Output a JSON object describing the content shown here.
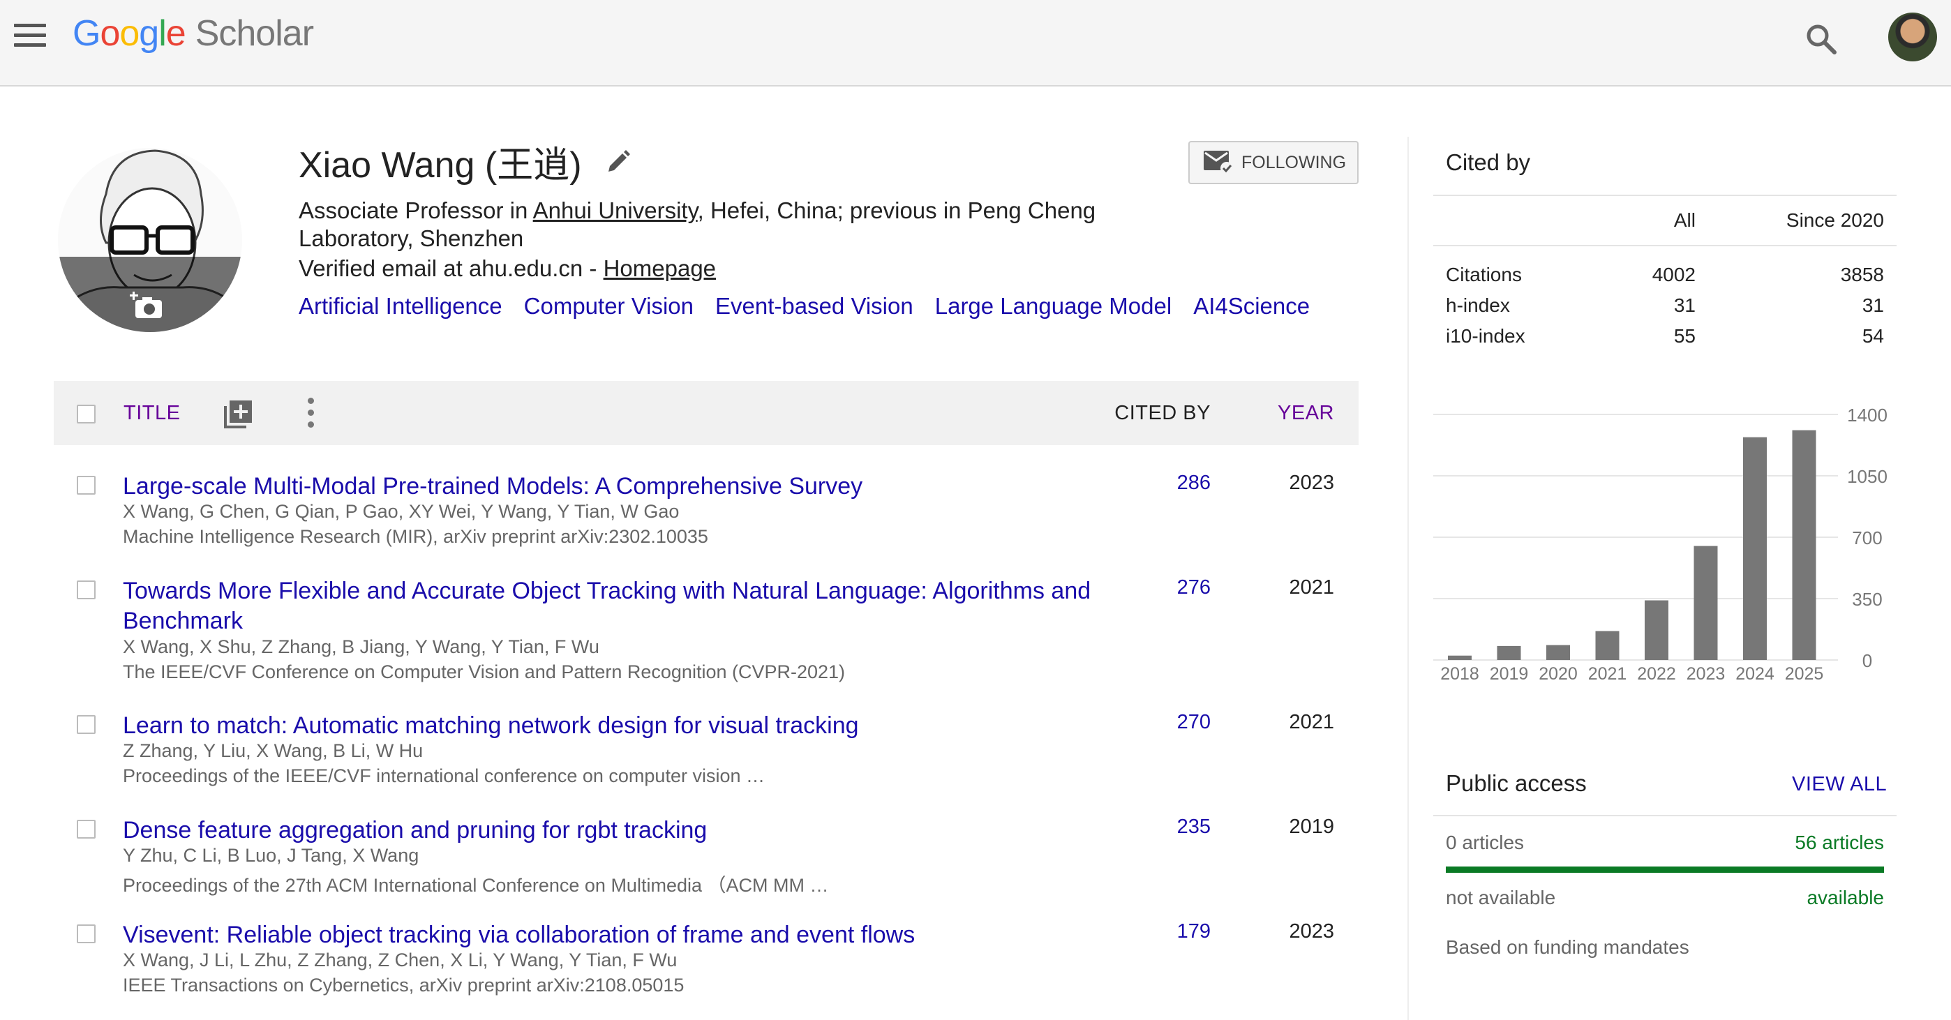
{
  "header": {
    "logo_google": "Google",
    "logo_scholar": "Scholar"
  },
  "profile": {
    "name": "Xiao Wang (王逍)",
    "affiliation_prefix": "Associate Professor in ",
    "affiliation_link": "Anhui University",
    "affiliation_suffix": ", Hefei, China; previous in Peng Cheng Laboratory, Shenzhen",
    "email_text": "Verified email at ahu.edu.cn - ",
    "homepage_link": "Homepage",
    "interests": [
      "Artificial Intelligence",
      "Computer Vision",
      "Event-based Vision",
      "Large Language Model",
      "AI4Science"
    ],
    "follow_label": "FOLLOWING"
  },
  "table": {
    "title_header": "TITLE",
    "cited_by_header": "CITED BY",
    "year_header": "YEAR",
    "articles": [
      {
        "title": "Large-scale Multi-Modal Pre-trained Models: A Comprehensive Survey",
        "authors": "X Wang, G Chen, G Qian, P Gao, XY Wei, Y Wang, Y Tian, W Gao",
        "venue": "Machine Intelligence Research (MIR), arXiv preprint arXiv:2302.10035",
        "cited_by": "286",
        "year": "2023"
      },
      {
        "title": "Towards More Flexible and Accurate Object Tracking with Natural Language: Algorithms and Benchmark",
        "authors": "X Wang, X Shu, Z Zhang, B Jiang, Y Wang, Y Tian, F Wu",
        "venue": "The IEEE/CVF Conference on Computer Vision and Pattern Recognition (CVPR-2021)",
        "cited_by": "276",
        "year": "2021"
      },
      {
        "title": "Learn to match: Automatic matching network design for visual tracking",
        "authors": "Z Zhang, Y Liu, X Wang, B Li, W Hu",
        "venue": "Proceedings of the IEEE/CVF international conference on computer vision …",
        "cited_by": "270",
        "year": "2021"
      },
      {
        "title": "Dense feature aggregation and pruning for rgbt tracking",
        "authors": "Y Zhu, C Li, B Luo, J Tang, X Wang",
        "venue": "Proceedings of the 27th ACM International Conference on Multimedia （ACM MM …",
        "cited_by": "235",
        "year": "2019"
      },
      {
        "title": "Visevent: Reliable object tracking via collaboration of frame and event flows",
        "authors": "X Wang, J Li, L Zhu, Z Zhang, Z Chen, X Li, Y Wang, Y Tian, F Wu",
        "venue": "IEEE Transactions on Cybernetics, arXiv preprint arXiv:2108.05015",
        "cited_by": "179",
        "year": "2023"
      }
    ]
  },
  "cited_by": {
    "heading": "Cited by",
    "col_all": "All",
    "col_since": "Since 2020",
    "rows": [
      {
        "label": "Citations",
        "all": "4002",
        "since": "3858"
      },
      {
        "label": "h-index",
        "all": "31",
        "since": "31"
      },
      {
        "label": "i10-index",
        "all": "55",
        "since": "54"
      }
    ]
  },
  "chart_data": {
    "type": "bar",
    "categories": [
      "2018",
      "2019",
      "2020",
      "2021",
      "2022",
      "2023",
      "2024",
      "2025"
    ],
    "values": [
      25,
      80,
      85,
      165,
      340,
      650,
      1270,
      1310
    ],
    "ylim": [
      0,
      1400
    ],
    "yticks": [
      "1400",
      "1050",
      "700",
      "350",
      "0"
    ],
    "bar_color": "#777777",
    "grid": true
  },
  "public_access": {
    "heading": "Public access",
    "view_all": "VIEW ALL",
    "unavailable_count": "0 articles",
    "available_count": "56 articles",
    "unavailable_label": "not available",
    "available_label": "available",
    "available_fraction": 1.0,
    "note": "Based on funding mandates",
    "available_color": "#0a7a25"
  }
}
